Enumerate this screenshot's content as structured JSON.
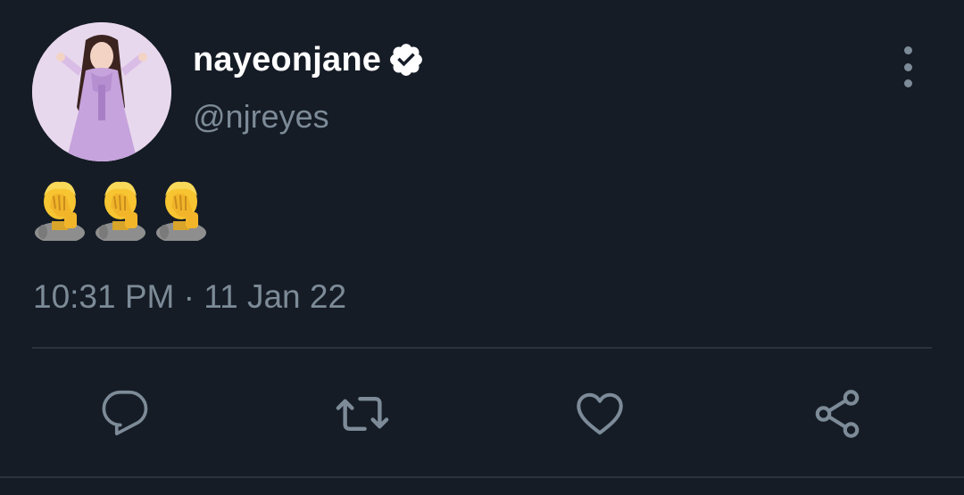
{
  "tweet": {
    "display_name": "nayeonjane",
    "verified": true,
    "handle": "@njreyes",
    "content_emojis": [
      "face-palm-emoji",
      "face-palm-emoji",
      "face-palm-emoji"
    ],
    "timestamp": "10:31 PM · 11 Jan 22"
  },
  "actions": {
    "reply": "reply-icon",
    "retweet": "retweet-icon",
    "like": "heart-icon",
    "share": "share-icon"
  },
  "colors": {
    "background": "#151c26",
    "primary_text": "#ffffff",
    "secondary_text": "#7d8b98",
    "divider": "#2a333e",
    "icon": "#7d8b98"
  }
}
